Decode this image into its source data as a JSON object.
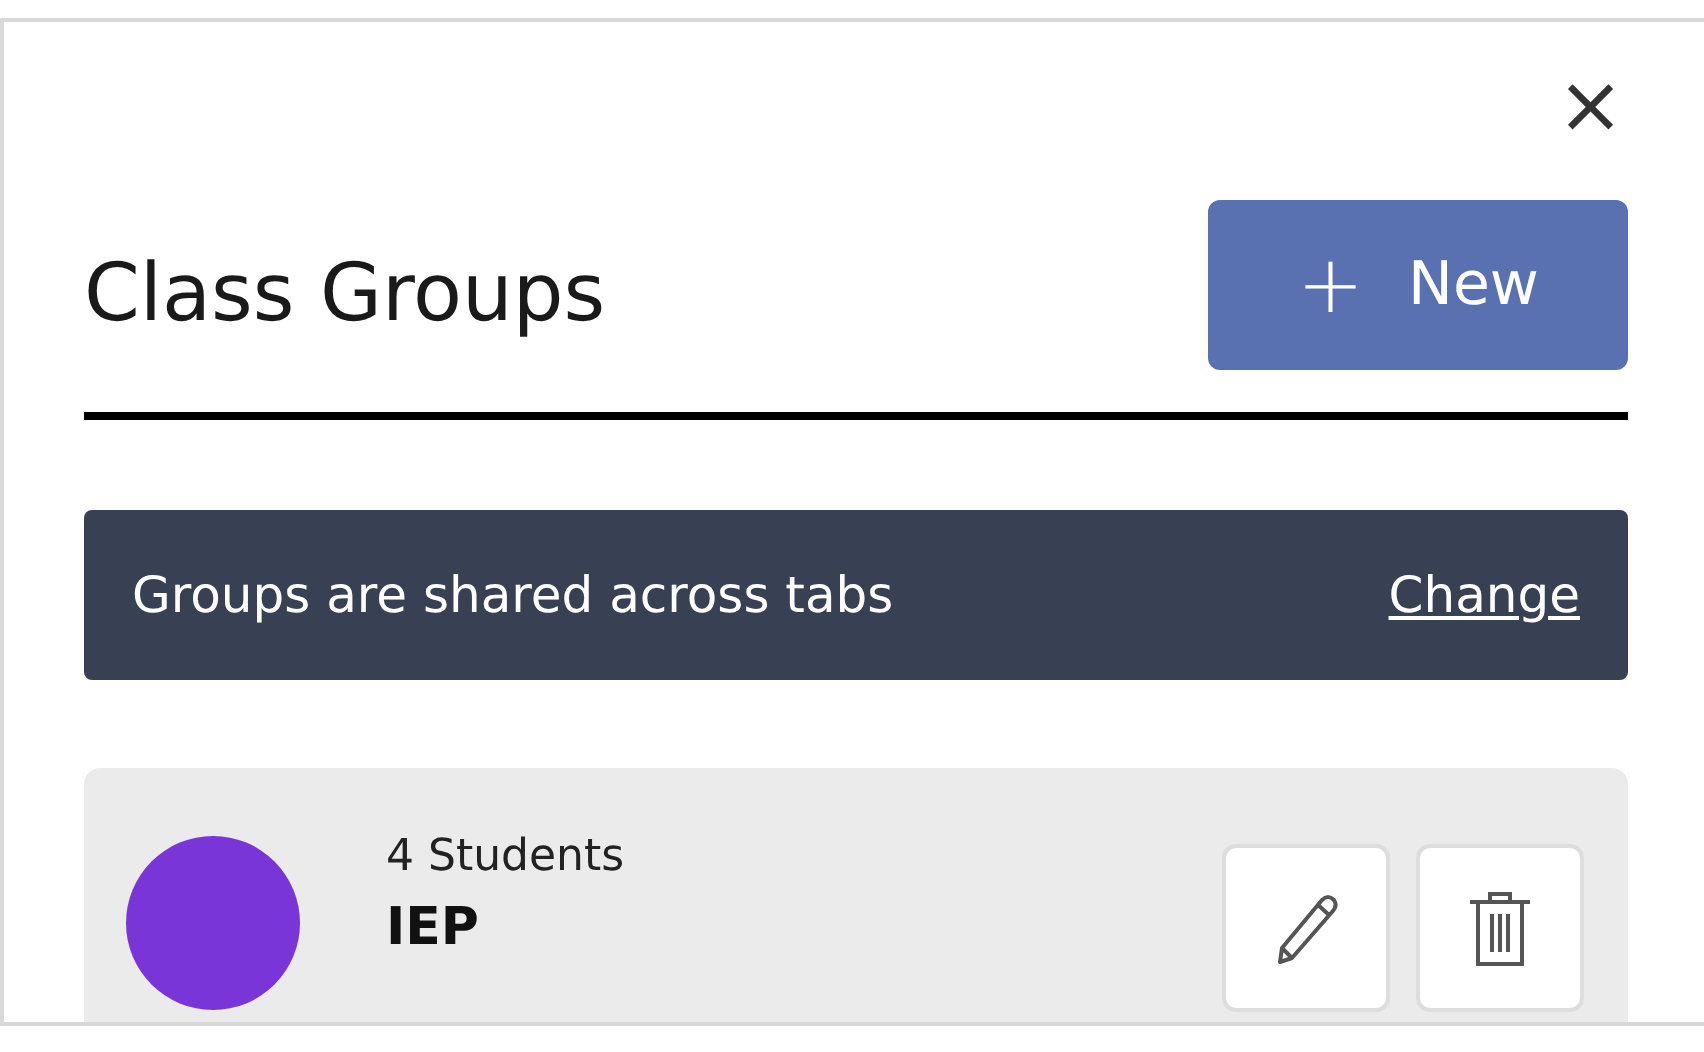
{
  "dialog": {
    "close": "×",
    "title": "Class Groups",
    "new_button": {
      "icon": "+",
      "label": "New"
    }
  },
  "banner": {
    "text": "Groups are shared across tabs",
    "link": "Change"
  },
  "groups": [
    {
      "count": "4 Students",
      "name": "IEP",
      "color": "#7a35d8"
    }
  ]
}
